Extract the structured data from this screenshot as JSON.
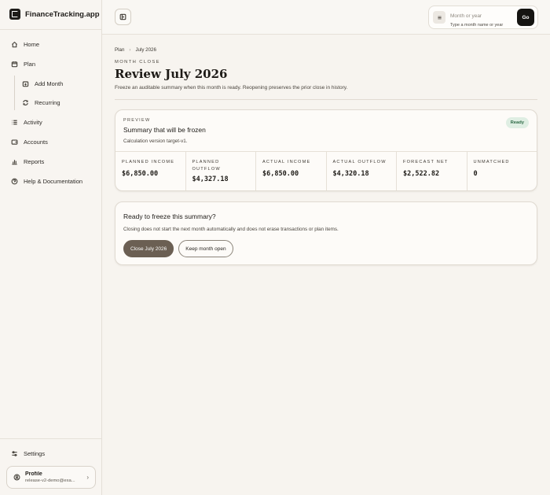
{
  "app": {
    "brand": "FinanceTracking.app"
  },
  "sidebar": {
    "items": [
      {
        "label": "Home",
        "icon": "home-icon"
      },
      {
        "label": "Plan",
        "icon": "calendar-icon"
      },
      {
        "label": "Add Month",
        "icon": "calendar-plus-icon"
      },
      {
        "label": "Recurring",
        "icon": "repeat-icon"
      },
      {
        "label": "Activity",
        "icon": "list-icon"
      },
      {
        "label": "Accounts",
        "icon": "wallet-icon"
      },
      {
        "label": "Reports",
        "icon": "bar-chart-icon"
      },
      {
        "label": "Help & Documentation",
        "icon": "help-icon"
      }
    ],
    "settings_label": "Settings",
    "profile": {
      "name": "Profile",
      "email": "release-v2-demo@exa..."
    }
  },
  "topbar": {
    "search": {
      "placeholder": "Month or year",
      "hint": "Type a month name or year"
    },
    "go_label": "Go"
  },
  "breadcrumb": {
    "parent": "Plan",
    "current": "July 2026"
  },
  "header": {
    "eyebrow": "MONTH CLOSE",
    "title": "Review July 2026",
    "subtitle": "Freeze an auditable summary when this month is ready. Reopening preserves the prior close in history."
  },
  "preview_card": {
    "eyebrow": "PREVIEW",
    "title": "Summary that will be frozen",
    "subtitle": "Calculation version target-v1.",
    "badge": "Ready",
    "metrics": [
      {
        "label": "Planned income",
        "value": "$6,850.00"
      },
      {
        "label": "Planned outflow",
        "value": "$4,327.18"
      },
      {
        "label": "Actual income",
        "value": "$6,850.00"
      },
      {
        "label": "Actual outflow",
        "value": "$4,320.18"
      },
      {
        "label": "Forecast net",
        "value": "$2,522.82"
      },
      {
        "label": "Unmatched",
        "value": "0"
      }
    ]
  },
  "freeze_card": {
    "title": "Ready to freeze this summary?",
    "subtitle": "Closing does not start the next month automatically and does not erase transactions or plan items.",
    "primary_label": "Close July 2026",
    "secondary_label": "Keep month open"
  },
  "colors": {
    "background": "#f7f4ef",
    "primary_button": "#6b5f53",
    "badge_bg": "#dfeee3",
    "badge_text": "#2f6b47",
    "go_button": "#151411"
  }
}
